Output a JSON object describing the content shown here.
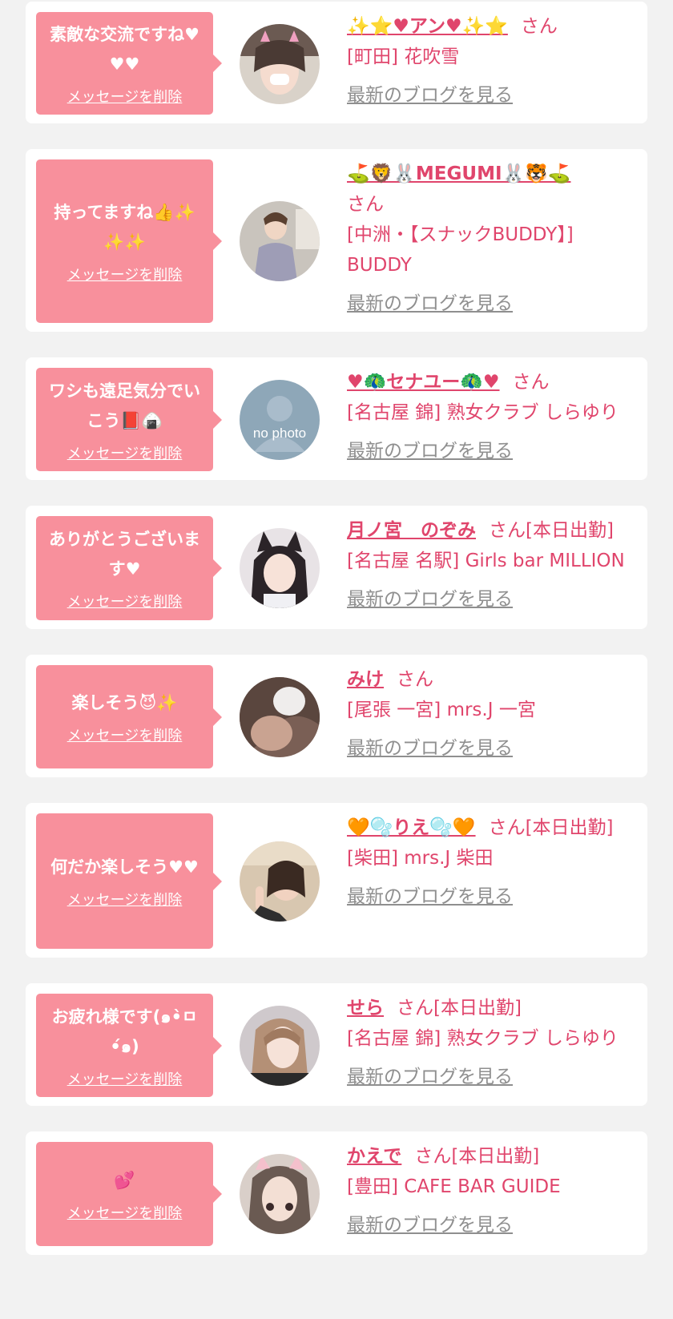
{
  "colors": {
    "bubble": "#f8909c",
    "accent": "#e0456c",
    "link_gray": "#8f8f8f",
    "background": "#f2f2f2"
  },
  "delete_label": "メッセージを削除",
  "blog_label": "最新のブログを見る",
  "san_label": "さん",
  "messages": [
    {
      "message": "素敵な交流ですね♥♥♥",
      "name": "✨⭐♥アン♥✨⭐",
      "suffix": "",
      "shop": "[町田] 花吹雪",
      "avatar_icon": "profile-photo-cat-filter"
    },
    {
      "message": "持ってますね👍✨✨✨",
      "name": "⛳🦁🐰MEGUMI🐰🐯⛳",
      "suffix": "",
      "shop": "[中洲・【スナックBUDDY】] BUDDY",
      "avatar_icon": "profile-photo-kimono"
    },
    {
      "message": "ワシも遠足気分でいこう📕🍙",
      "name": "♥🦚セナユー🦚♥",
      "suffix": "",
      "shop": "[名古屋 錦] 熟女クラブ しらゆり",
      "avatar_icon": "no-photo-placeholder"
    },
    {
      "message": "ありがとうございます♥",
      "name": "月ノ宮　のぞみ",
      "suffix": "[本日出勤]",
      "shop": "[名古屋 名駅] Girls bar MILLION",
      "avatar_icon": "profile-photo-cat-ears"
    },
    {
      "message": "楽しそう😈✨",
      "name": "みけ",
      "suffix": "",
      "shop": "[尾張 一宮] mrs.J 一宮",
      "avatar_icon": "profile-photo-blurred"
    },
    {
      "message": "何だか楽しそう♥♥",
      "name": "🧡🫧りえ🫧🧡",
      "suffix": "[本日出勤]",
      "shop": "[柴田] mrs.J 柴田",
      "avatar_icon": "profile-photo-peace-sign"
    },
    {
      "message": "お疲れ様です(๑•̀ㅁ•́๑)",
      "name": "せら",
      "suffix": "[本日出勤]",
      "shop": "[名古屋 錦] 熟女クラブ しらゆり",
      "avatar_icon": "profile-photo-selfie"
    },
    {
      "message": "💕",
      "name": "かえで",
      "suffix": "[本日出勤]",
      "shop": "[豊田] CAFE BAR GUIDE",
      "avatar_icon": "profile-photo-paw-filter"
    }
  ]
}
